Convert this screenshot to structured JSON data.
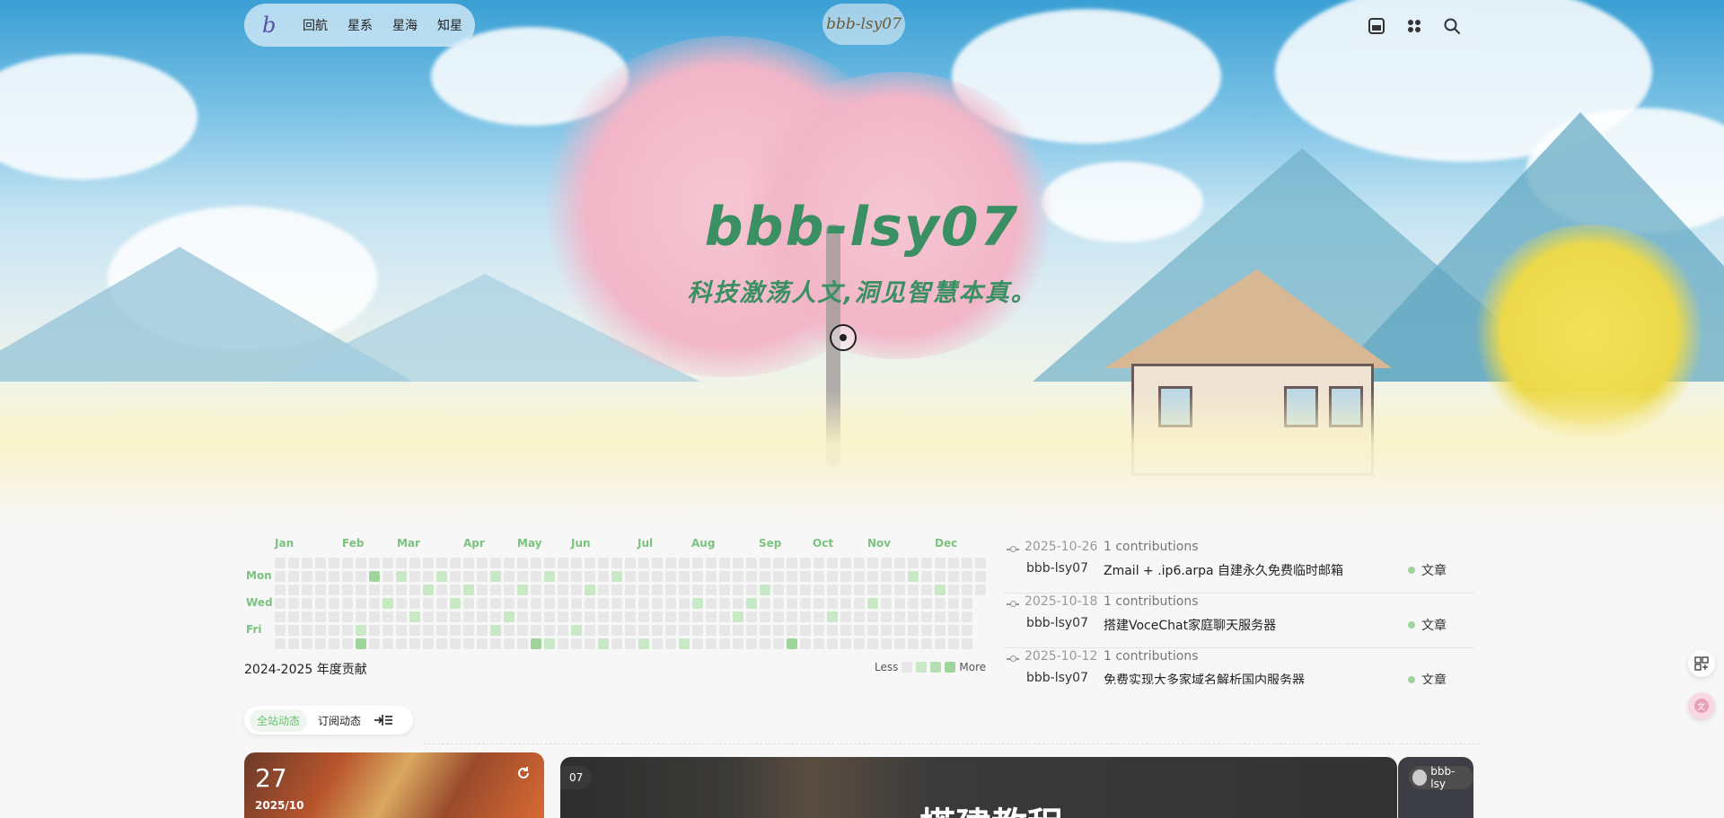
{
  "nav": {
    "logo": "b",
    "items": [
      "回航",
      "星系",
      "星海",
      "知星"
    ],
    "center_logo": "bbb-lsy07",
    "right_icons": [
      "window-icon",
      "grid-icon",
      "search-icon"
    ]
  },
  "hero": {
    "title": "bbb-lsy07",
    "subtitle": "科技激荡人文,洞见智慧本真。"
  },
  "contrib": {
    "months": [
      "Jan",
      "Feb",
      "Mar",
      "Apr",
      "May",
      "Jun",
      "Jul",
      "Aug",
      "Sep",
      "Oct",
      "Nov",
      "Dec"
    ],
    "days": [
      "Mon",
      "Wed",
      "Fri"
    ],
    "title": "2024-2025 年度贡献",
    "legend_less": "Less",
    "legend_more": "More",
    "colors": {
      "empty": "#e7e7e7",
      "l1": "#c8e8c6",
      "l2": "#9fd59d",
      "accent": "#7cc27f"
    }
  },
  "activity": [
    {
      "date": "2025-10-26",
      "count": "1 contributions",
      "user": "bbb-lsy07",
      "title": "Zmail + .ip6.arpa 自建永久免费临时邮箱",
      "tag": "文章"
    },
    {
      "date": "2025-10-18",
      "count": "1 contributions",
      "user": "bbb-lsy07",
      "title": "搭建VoceChat家庭聊天服务器",
      "tag": "文章"
    },
    {
      "date": "2025-10-12",
      "count": "1 contributions",
      "user": "bbb-lsy07",
      "title": "免费实现大多家域名解析国内服务器",
      "tag": "文章"
    }
  ],
  "tabs": {
    "all": "全站动态",
    "subscribed": "订阅动态"
  },
  "cards": {
    "date_day": "27",
    "date_ym": "2025/10",
    "main_badge": "07",
    "main_text": "搭建教程",
    "right_badge": "bbb-lsy"
  }
}
